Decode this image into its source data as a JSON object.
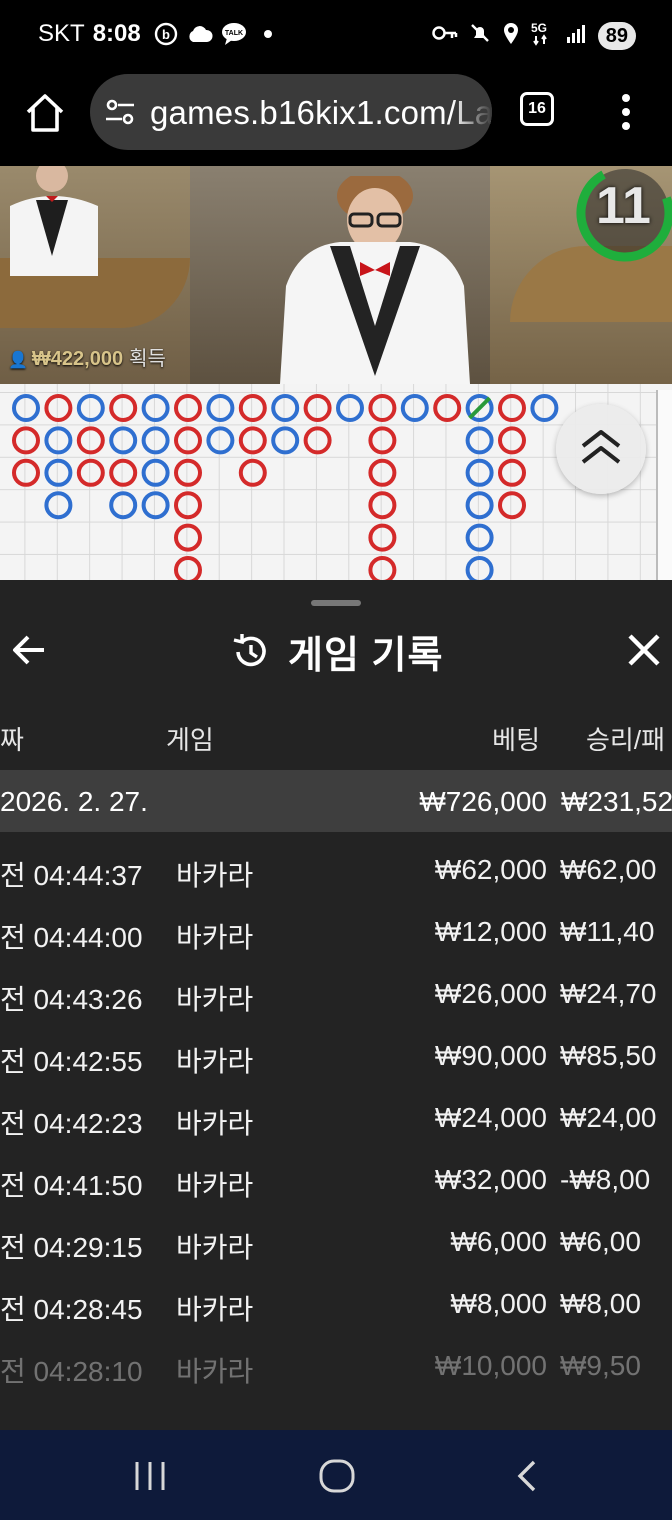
{
  "status_bar": {
    "carrier": "SKT",
    "time": "8:08",
    "battery": "89",
    "left_icons": [
      "b-circle-icon",
      "cloud-icon",
      "talk-bubble-icon",
      "dot-icon"
    ],
    "right_icons": [
      "key-icon",
      "mute-icon",
      "location-icon",
      "5g-icon",
      "signal-icon"
    ],
    "network_label": "5G"
  },
  "browser": {
    "url": "games.b16kix1.com/La",
    "tab_count": "16"
  },
  "video": {
    "timer": "11",
    "win_amount": "₩422,000",
    "win_label": "획득"
  },
  "roadmap": {
    "colors": {
      "banker": "#d42a2a",
      "player": "#2f6fd0",
      "tie": "#2a9a3a"
    },
    "columns": [
      [
        "P",
        "B",
        "B"
      ],
      [
        "B",
        "P",
        "P",
        "P"
      ],
      [
        "P",
        "B",
        "B"
      ],
      [
        "B",
        "P",
        "B",
        "P"
      ],
      [
        "P",
        "P",
        "P",
        "P"
      ],
      [
        "B",
        "B",
        "B",
        "B",
        "B",
        "B"
      ],
      [
        "P",
        "P"
      ],
      [
        "B",
        "B",
        "B"
      ],
      [
        "P",
        "P"
      ],
      [
        "B",
        "B"
      ],
      [
        "P"
      ],
      [
        "B",
        "B",
        "B",
        "B",
        "B",
        "B"
      ],
      [
        "P"
      ],
      [
        "B"
      ],
      [
        "P",
        "P",
        "P",
        "P",
        "P",
        "P"
      ],
      [
        "B",
        "B",
        "B",
        "B"
      ],
      [
        "P"
      ]
    ]
  },
  "sheet": {
    "title": "게임 기록",
    "headers": {
      "date": "짜",
      "game": "게임",
      "bet": "베팅",
      "winloss": "승리/패"
    },
    "date_row": {
      "date": "2026. 2. 27.",
      "bet": "₩726,000",
      "winloss": "₩231,52"
    },
    "rows": [
      {
        "time": "전 04:44:37",
        "game": "바카라",
        "bet": "₩62,000",
        "winloss": "₩62,00"
      },
      {
        "time": "전 04:44:00",
        "game": "바카라",
        "bet": "₩12,000",
        "winloss": "₩11,40"
      },
      {
        "time": "전 04:43:26",
        "game": "바카라",
        "bet": "₩26,000",
        "winloss": "₩24,70"
      },
      {
        "time": "전 04:42:55",
        "game": "바카라",
        "bet": "₩90,000",
        "winloss": "₩85,50"
      },
      {
        "time": "전 04:42:23",
        "game": "바카라",
        "bet": "₩24,000",
        "winloss": "₩24,00"
      },
      {
        "time": "전 04:41:50",
        "game": "바카라",
        "bet": "₩32,000",
        "winloss": "-₩8,00"
      },
      {
        "time": "전 04:29:15",
        "game": "바카라",
        "bet": "₩6,000",
        "winloss": "₩6,00"
      },
      {
        "time": "전 04:28:45",
        "game": "바카라",
        "bet": "₩8,000",
        "winloss": "₩8,00"
      },
      {
        "time": "전 04:28:10",
        "game": "바카라",
        "bet": "₩10,000",
        "winloss": "₩9,50"
      }
    ]
  }
}
